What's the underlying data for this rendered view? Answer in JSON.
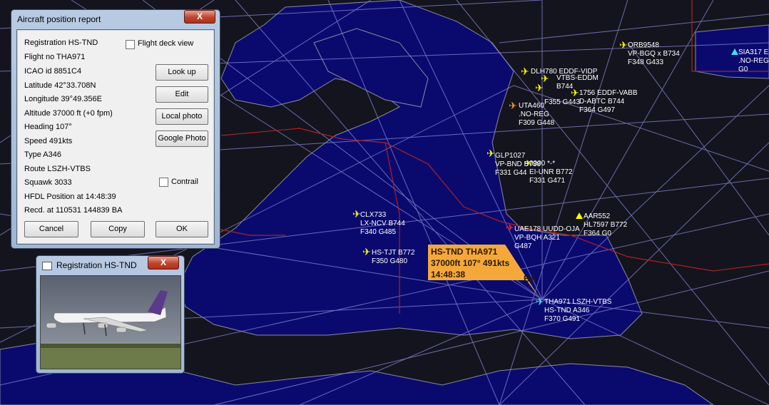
{
  "report": {
    "title": "Aircraft position report",
    "registration": "Registration HS-TND",
    "flight_no": "Flight no THA971",
    "icao": "ICAO id 8851C4",
    "latitude": "Latitude  42°33.708N",
    "longitude": "Longitude  39°49.356E",
    "altitude": "Altitude 37000 ft (+0 fpm)",
    "heading": "Heading  107°",
    "speed": "Speed   491kts",
    "type": "Type A346",
    "route": "Route LSZH-VTBS",
    "squawk": "Squawk 3033",
    "hfdl": "HFDL Position at 14:48:39",
    "recd": "Recd. at 110531 144839 BA",
    "flight_deck_label": "Flight deck view",
    "contrail_label": "Contrail",
    "buttons": {
      "lookup": "Look up",
      "edit": "Edit",
      "local_photo": "Local photo",
      "google_photo": "Google Photo",
      "cancel": "Cancel",
      "copy": "Copy",
      "ok": "OK"
    },
    "close": "X"
  },
  "photo_window": {
    "title": "Registration HS-TND",
    "close": "X"
  },
  "selected_tag": {
    "line1": "HS-TND THA971",
    "line2": "37000ft 107° 491kts",
    "line3": "14:48:38",
    "suffix": "BA"
  },
  "aircraft": [
    {
      "id": "orb9548",
      "l1": "ORB9548",
      "l2": "VP-BGQ x B734",
      "l3": "F348 G433",
      "color": "#ffff00"
    },
    {
      "id": "sia317",
      "l1": "SIA317 E",
      "l2": ".NO-REG",
      "l3": "G0",
      "color": "#40e0f0"
    },
    {
      "id": "dlh780",
      "l1": "DLH780 EDDF-VIDP",
      "l2": "",
      "l3": "",
      "color": "#ffff00"
    },
    {
      "id": "cluster1",
      "l1": "VTBS-EDDM",
      "l2": "B744",
      "l3": "",
      "color": "#ffff00"
    },
    {
      "id": "dlh756",
      "l1": "1756 EDDF-VABB",
      "l2": "D-ABTC B744",
      "l3": "F364 G497",
      "color": "#ffff00"
    },
    {
      "id": "cluster2",
      "l1": "F355 G443",
      "l2": "",
      "l3": "",
      "color": "#ffff00"
    },
    {
      "id": "uta460",
      "l1": "UTA460",
      "l2": ".NO-REG",
      "l3": "F309 G448",
      "color": "#ff9a30"
    },
    {
      "id": "glp1027",
      "l1": "GLP1027",
      "l2": "VP-BND B738",
      "l3": "F331 G44",
      "color": "#ffff00"
    },
    {
      "id": "ei",
      "l1": "0000 *-*",
      "l2": "EI-UNR B772",
      "l3": "F331 G471",
      "color": "#ffff00"
    },
    {
      "id": "clx733",
      "l1": "CLX733",
      "l2": "LX-NCV B744",
      "l3": "F340 G485",
      "color": "#ffff00"
    },
    {
      "id": "aar552",
      "l1": "AAR552",
      "l2": "HL7597 B772",
      "l3": "F364 G0",
      "color": "#ffff00"
    },
    {
      "id": "uae",
      "l1": "UAE178 UUDD-OJA",
      "l2": "VP-BQH A321",
      "l3": "G487",
      "color": "#ff2020"
    },
    {
      "id": "tjt",
      "l1": "HS-TJT B772",
      "l2": "F350 G480",
      "l3": "",
      "color": "#ffff00"
    },
    {
      "id": "tha971",
      "l1": "THA971 LSZH-VTBS",
      "l2": "HS-TND A346",
      "l3": "F370 G491",
      "color": "#40e0f0"
    }
  ]
}
